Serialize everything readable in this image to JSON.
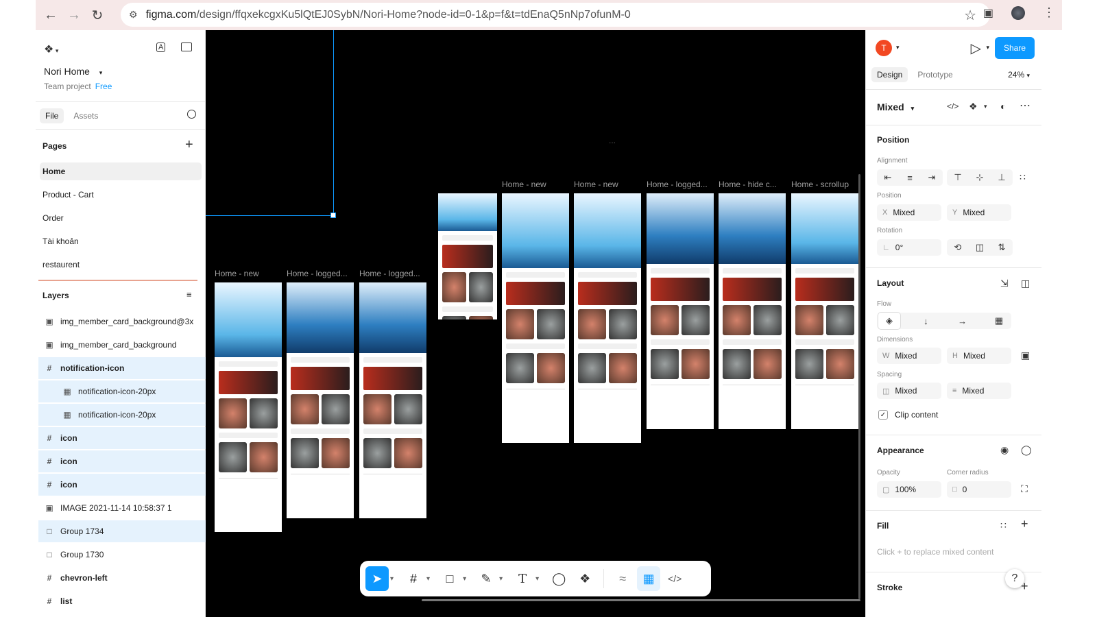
{
  "browser": {
    "url_host": "figma.com",
    "url_path": "/design/ffqxekcgxKu5lQtEJ0SybN/Nori-Home?node-id=0-1&p=f&t=tdEnaQ5nNp7ofunM-0"
  },
  "file": {
    "name": "Nori Home",
    "team": "Team project",
    "plan": "Free"
  },
  "left_tabs": [
    "File",
    "Assets"
  ],
  "pages_header": "Pages",
  "pages": [
    "Home",
    "Product - Cart",
    "Order",
    "Tài khoản",
    "restaurent"
  ],
  "layers_header": "Layers",
  "layers": [
    {
      "label": "img_member_card_background@3x",
      "icon": "image-icon",
      "sel": false,
      "indent": false,
      "bold": false
    },
    {
      "label": "img_member_card_background",
      "icon": "image-icon",
      "sel": false,
      "indent": false,
      "bold": false
    },
    {
      "label": "notification-icon",
      "icon": "frame-icon",
      "sel": true,
      "indent": false,
      "bold": true
    },
    {
      "label": "notification-icon-20px",
      "icon": "component-instance-icon",
      "sel": true,
      "indent": true,
      "bold": false
    },
    {
      "label": "notification-icon-20px",
      "icon": "component-instance-icon",
      "sel": true,
      "indent": true,
      "bold": false
    },
    {
      "label": "icon",
      "icon": "frame-icon",
      "sel": true,
      "indent": false,
      "bold": true
    },
    {
      "label": "icon",
      "icon": "frame-icon",
      "sel": true,
      "indent": false,
      "bold": true
    },
    {
      "label": "icon",
      "icon": "frame-icon",
      "sel": true,
      "indent": false,
      "bold": true
    },
    {
      "label": "IMAGE 2021-11-14 10:58:37 1",
      "icon": "image-icon",
      "sel": false,
      "indent": false,
      "bold": false
    },
    {
      "label": "Group 1734",
      "icon": "group-icon",
      "sel": true,
      "indent": false,
      "bold": false
    },
    {
      "label": "Group 1730",
      "icon": "group-icon",
      "sel": false,
      "indent": false,
      "bold": false
    },
    {
      "label": "chevron-left",
      "icon": "frame-icon",
      "sel": false,
      "indent": false,
      "bold": true
    },
    {
      "label": "list",
      "icon": "frame-icon",
      "sel": false,
      "indent": false,
      "bold": true
    }
  ],
  "canvas": {
    "frame_labels": [
      "Home - new",
      "Home - logged...",
      "Home - logged...",
      "Home - new",
      "Home - new",
      "Home - logged...",
      "Home - hide c...",
      "Home - scrollup"
    ],
    "overflow": "..."
  },
  "right": {
    "share": "Share",
    "avatar": "T",
    "tabs": [
      "Design",
      "Prototype"
    ],
    "zoom": "24%",
    "selection": "Mixed",
    "position_header": "Position",
    "alignment_label": "Alignment",
    "position_label": "Position",
    "x_prefix": "X",
    "x_value": "Mixed",
    "y_prefix": "Y",
    "y_value": "Mixed",
    "rotation_label": "Rotation",
    "rotation_value": "0°",
    "layout_header": "Layout",
    "flow_label": "Flow",
    "dimensions_label": "Dimensions",
    "w_prefix": "W",
    "w_value": "Mixed",
    "h_prefix": "H",
    "h_value": "Mixed",
    "spacing_label": "Spacing",
    "spacing_h": "Mixed",
    "spacing_v": "Mixed",
    "clip_content": "Clip content",
    "appearance_header": "Appearance",
    "opacity_label": "Opacity",
    "opacity_value": "100%",
    "corner_label": "Corner radius",
    "corner_value": "0",
    "fill_header": "Fill",
    "fill_placeholder": "Click + to replace mixed content",
    "stroke_header": "Stroke",
    "help": "?"
  },
  "colors": {
    "accent": "#0d99ff",
    "avatar": "#f24822",
    "canvas": "#000000",
    "selection_bg": "#e5f2fd"
  }
}
